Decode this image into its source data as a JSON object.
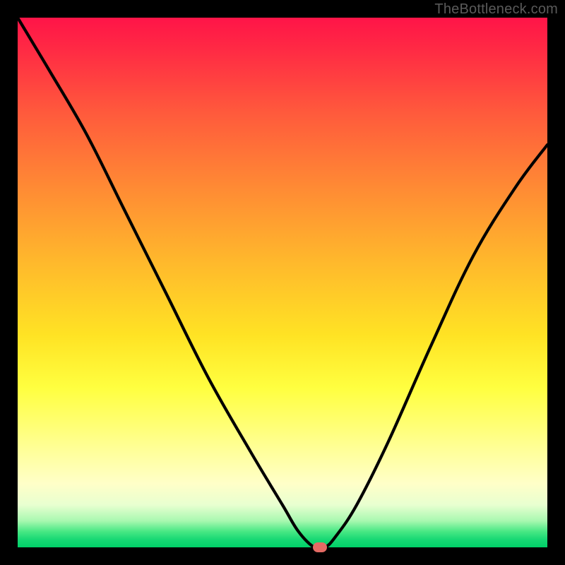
{
  "watermark": "TheBottleneck.com",
  "colors": {
    "frame": "#000000",
    "gradient_top": "#ff1448",
    "gradient_bottom": "#00d068",
    "curve": "#000000",
    "marker": "#e46a64",
    "watermark": "#5a5a5a"
  },
  "chart_data": {
    "type": "line",
    "title": "",
    "xlabel": "",
    "ylabel": "",
    "xlim": [
      0,
      100
    ],
    "ylim": [
      0,
      100
    ],
    "grid": false,
    "legend": false,
    "annotations": [],
    "series": [
      {
        "name": "bottleneck-curve",
        "x": [
          0,
          6,
          13,
          20,
          28,
          36,
          44,
          50,
          53,
          56,
          58,
          60,
          64,
          70,
          78,
          86,
          94,
          100
        ],
        "values": [
          100,
          90,
          78,
          64,
          48,
          32,
          18,
          8,
          3,
          0,
          0,
          2,
          8,
          20,
          38,
          55,
          68,
          76
        ]
      }
    ],
    "marker": {
      "x": 57,
      "y": 0,
      "shape": "rounded-rect",
      "color": "#e46a64"
    }
  }
}
